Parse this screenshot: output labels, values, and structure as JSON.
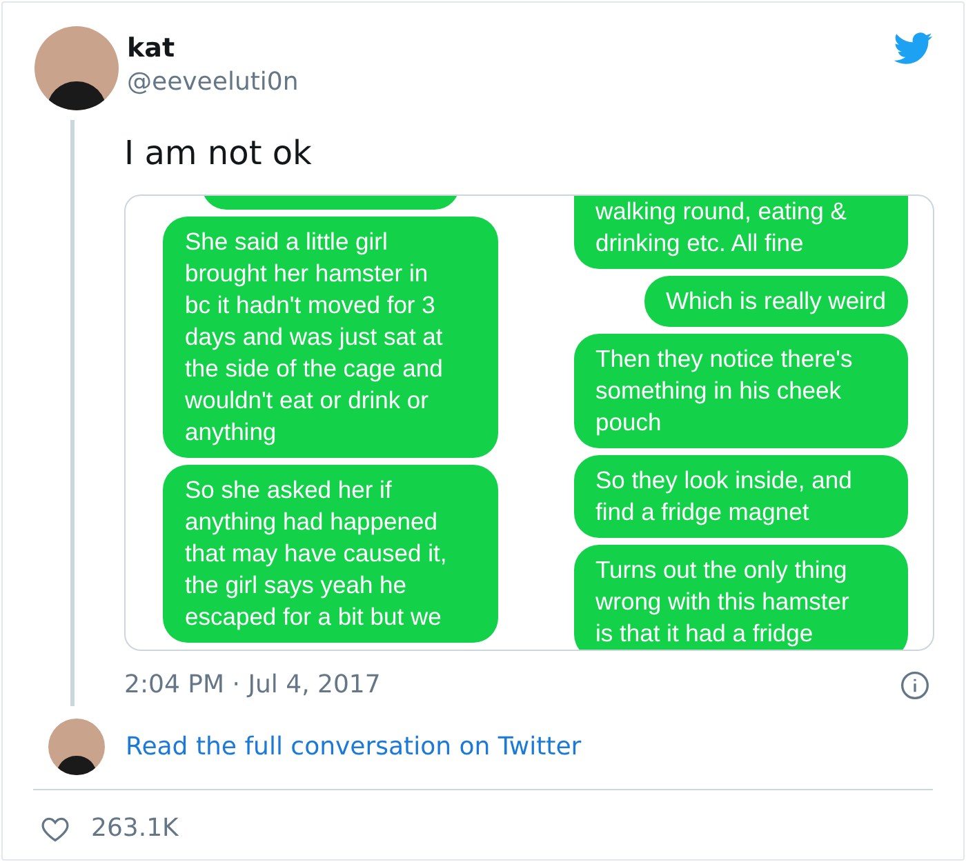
{
  "author": {
    "name": "kat",
    "handle": "@eeveeluti0n"
  },
  "tweet": {
    "text": "I am not ok"
  },
  "screenshot": {
    "columns": [
      {
        "bubbles": [
          {
            "kind": "partial"
          },
          {
            "kind": "full",
            "text": "She said a little girl\nbrought her hamster in\nbc it hadn't moved for 3\ndays and was just sat at\nthe side of the cage and\nwouldn't eat or drink or\nanything"
          },
          {
            "kind": "full",
            "text": "So she asked her if\nanything had happened\nthat may have caused it,\nthe girl says yeah he\nescaped for a bit but we"
          }
        ]
      },
      {
        "bubbles": [
          {
            "kind": "full",
            "text": "walking round, eating &\ndrinking etc. All fine"
          },
          {
            "kind": "short",
            "text": "Which is really weird"
          },
          {
            "kind": "full",
            "text": "Then they notice there's\nsomething in his cheek\npouch"
          },
          {
            "kind": "full",
            "text": "So they look inside, and\nfind a fridge magnet"
          },
          {
            "kind": "full",
            "text": "Turns out the only thing\nwrong with this hamster\nis that it had a fridge"
          }
        ]
      }
    ]
  },
  "timestamp": "2:04 PM · Jul 4, 2017",
  "conversation_link": "Read the full conversation on Twitter",
  "likes": "263.1K"
}
